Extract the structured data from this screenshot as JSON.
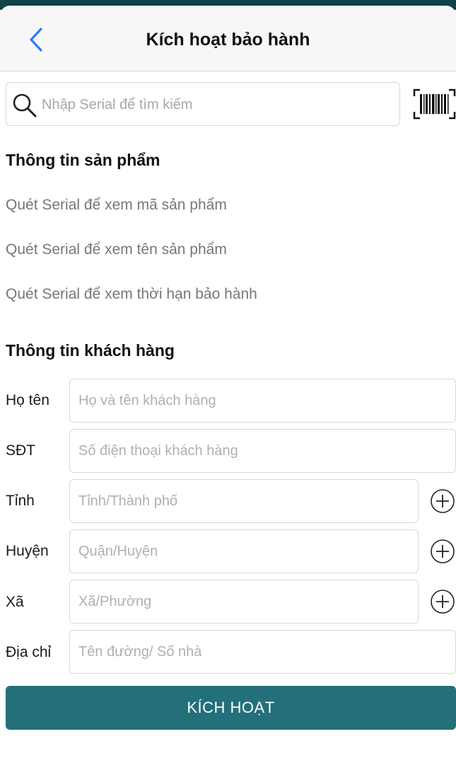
{
  "header": {
    "title": "Kích hoạt bảo hành",
    "back_icon": "chevron-left-icon"
  },
  "search": {
    "placeholder": "Nhập Serial để tìm kiếm",
    "value": "",
    "icon": "search-icon",
    "scan_icon": "barcode-scan-icon"
  },
  "product_info": {
    "title": "Thông tin sản phẩm",
    "code_text": "Quét Serial để xem mã sản phẩm",
    "name_text": "Quét Serial để xem tên sản phẩm",
    "warranty_text": "Quét Serial để xem thời hạn bảo hành"
  },
  "customer_info": {
    "title": "Thông tin khách hàng",
    "fields": {
      "name": {
        "label": "Họ tên",
        "placeholder": "Họ và tên khách hàng",
        "value": ""
      },
      "phone": {
        "label": "SĐT",
        "placeholder": "Số điện thoại khách hàng",
        "value": ""
      },
      "province": {
        "label": "Tỉnh",
        "placeholder": "Tỉnh/Thành phố",
        "value": ""
      },
      "district": {
        "label": "Huyện",
        "placeholder": "Quận/Huyện",
        "value": ""
      },
      "ward": {
        "label": "Xã",
        "placeholder": "Xã/Phường",
        "value": ""
      },
      "address": {
        "label": "Địa chỉ",
        "placeholder": "Tên đường/ Số nhà",
        "value": ""
      }
    },
    "add_icon": "plus-circle-icon"
  },
  "actions": {
    "activate_label": "KÍCH HOẠT"
  },
  "colors": {
    "accent": "#236f7a",
    "back_icon": "#2f7bf5",
    "status_bar": "#10424a",
    "nav_background": "#f7f7f7",
    "placeholder": "#a8a8a8"
  }
}
